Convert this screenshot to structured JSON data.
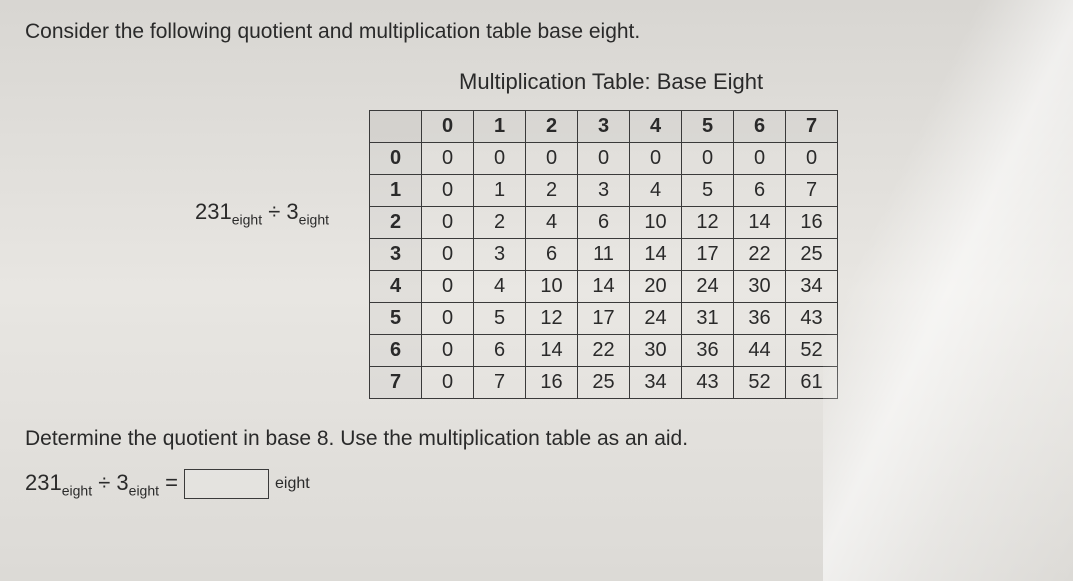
{
  "intro": "Consider the following quotient and multiplication table base eight.",
  "expression": {
    "dividend": "231",
    "dividend_sub": "eight",
    "operator": "÷",
    "divisor": "3",
    "divisor_sub": "eight"
  },
  "table": {
    "title": "Multiplication Table: Base Eight",
    "headers": [
      "0",
      "1",
      "2",
      "3",
      "4",
      "5",
      "6",
      "7"
    ],
    "rows": [
      {
        "h": "0",
        "cells": [
          "0",
          "0",
          "0",
          "0",
          "0",
          "0",
          "0",
          "0"
        ]
      },
      {
        "h": "1",
        "cells": [
          "0",
          "1",
          "2",
          "3",
          "4",
          "5",
          "6",
          "7"
        ]
      },
      {
        "h": "2",
        "cells": [
          "0",
          "2",
          "4",
          "6",
          "10",
          "12",
          "14",
          "16"
        ]
      },
      {
        "h": "3",
        "cells": [
          "0",
          "3",
          "6",
          "11",
          "14",
          "17",
          "22",
          "25"
        ]
      },
      {
        "h": "4",
        "cells": [
          "0",
          "4",
          "10",
          "14",
          "20",
          "24",
          "30",
          "34"
        ]
      },
      {
        "h": "5",
        "cells": [
          "0",
          "5",
          "12",
          "17",
          "24",
          "31",
          "36",
          "43"
        ]
      },
      {
        "h": "6",
        "cells": [
          "0",
          "6",
          "14",
          "22",
          "30",
          "36",
          "44",
          "52"
        ]
      },
      {
        "h": "7",
        "cells": [
          "0",
          "7",
          "16",
          "25",
          "34",
          "43",
          "52",
          "61"
        ]
      }
    ]
  },
  "instruction": "Determine the quotient in base 8. Use the multiplication table as an aid.",
  "answer": {
    "dividend": "231",
    "dividend_sub": "eight",
    "operator": "÷",
    "divisor": "3",
    "divisor_sub": "eight",
    "equals": "=",
    "result_sub": "eight"
  }
}
